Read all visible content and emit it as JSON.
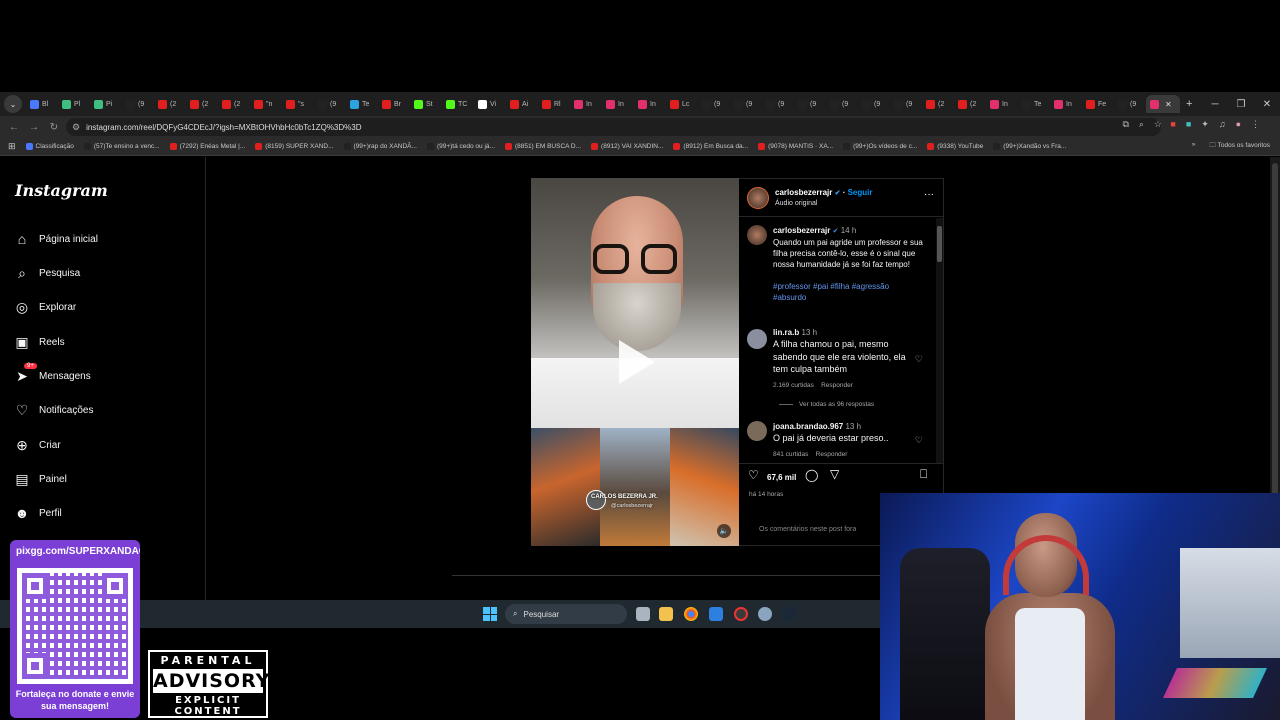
{
  "browser": {
    "tabs": [
      {
        "label": "Bl",
        "color": "#4a79ff"
      },
      {
        "label": "Pl",
        "color": "#3fbf7f"
      },
      {
        "label": "Pi",
        "color": "#3fbf7f"
      },
      {
        "label": "(9",
        "color": "#222222"
      },
      {
        "label": "(2",
        "color": "#e02020"
      },
      {
        "label": "(2",
        "color": "#e02020"
      },
      {
        "label": "(2",
        "color": "#e02020"
      },
      {
        "label": "\"n",
        "color": "#e02020"
      },
      {
        "label": "\"s",
        "color": "#e02020"
      },
      {
        "label": "(9",
        "color": "#222222"
      },
      {
        "label": "Te",
        "color": "#2aa3e0"
      },
      {
        "label": "Br",
        "color": "#e02020"
      },
      {
        "label": "St",
        "color": "#53fc18"
      },
      {
        "label": "TC",
        "color": "#53fc18"
      },
      {
        "label": "Vi",
        "color": "#ffffff"
      },
      {
        "label": "Ai",
        "color": "#e02020"
      },
      {
        "label": "Rl",
        "color": "#e02020"
      },
      {
        "label": "In",
        "color": "#e1306c"
      },
      {
        "label": "In",
        "color": "#e1306c"
      },
      {
        "label": "In",
        "color": "#e1306c"
      },
      {
        "label": "Lc",
        "color": "#e02020"
      },
      {
        "label": "(9",
        "color": "#222222"
      },
      {
        "label": "(9",
        "color": "#222222"
      },
      {
        "label": "(9",
        "color": "#222222"
      },
      {
        "label": "(9",
        "color": "#222222"
      },
      {
        "label": "(9",
        "color": "#222222"
      },
      {
        "label": "(9",
        "color": "#222222"
      },
      {
        "label": "(9",
        "color": "#222222"
      },
      {
        "label": "(2",
        "color": "#e02020"
      },
      {
        "label": "(2",
        "color": "#e02020"
      },
      {
        "label": "In",
        "color": "#e1306c"
      },
      {
        "label": "Te",
        "color": "#222222"
      },
      {
        "label": "In",
        "color": "#e1306c"
      },
      {
        "label": "Fe",
        "color": "#e02020"
      },
      {
        "label": "(9",
        "color": "#222222"
      },
      {
        "label": "",
        "color": "#e1306c",
        "active": true
      }
    ],
    "url": "instagram.com/reel/DQFyG4CDEcJ/?igsh=MXBtOHVhbHc0bTc1ZQ%3D%3D",
    "bookmarks": [
      {
        "label": "Classificação",
        "color": "#4a79ff"
      },
      {
        "label": "(57)Te ensino a venc...",
        "color": "#222222"
      },
      {
        "label": "(7292) Enéas Metal |...",
        "color": "#e02020"
      },
      {
        "label": "(8159) SUPER XAND...",
        "color": "#e02020"
      },
      {
        "label": "(99+)rap do XANDÃ...",
        "color": "#222222"
      },
      {
        "label": "(99+)tá cedo ou já...",
        "color": "#222222"
      },
      {
        "label": "(8851) EM BUSCA D...",
        "color": "#e02020"
      },
      {
        "label": "(8912) VAI XANDIN...",
        "color": "#e02020"
      },
      {
        "label": "(8912) Em Busca da...",
        "color": "#e02020"
      },
      {
        "label": "(9078) MANTIS · XA...",
        "color": "#e02020"
      },
      {
        "label": "(99+)Os vídeos de c...",
        "color": "#222222"
      },
      {
        "label": "(9338) YouTube",
        "color": "#e02020"
      },
      {
        "label": "(99+)Xandão vs Fra...",
        "color": "#222222"
      }
    ],
    "all_bookmarks_label": "Todos os favoritos"
  },
  "instagram": {
    "logo": "Instagram",
    "nav": [
      {
        "label": "Página inicial",
        "icon": "home-icon"
      },
      {
        "label": "Pesquisa",
        "icon": "search-icon"
      },
      {
        "label": "Explorar",
        "icon": "compass-icon"
      },
      {
        "label": "Reels",
        "icon": "reels-icon"
      },
      {
        "label": "Mensagens",
        "icon": "messages-icon",
        "badge": "9+"
      },
      {
        "label": "Notificações",
        "icon": "heart-icon"
      },
      {
        "label": "Criar",
        "icon": "plus-icon"
      },
      {
        "label": "Painel",
        "icon": "dashboard-icon"
      },
      {
        "label": "Perfil",
        "icon": "profile-icon"
      }
    ],
    "reel_overlay": {
      "name": "CARLOS BEZERRA JR.",
      "handle": "@carlosbezerrajr"
    },
    "post": {
      "username": "carlosbezerrajr",
      "follow": "Seguir",
      "audio": "Áudio original",
      "caption_user": "carlosbezerrajr",
      "caption_time": "14 h",
      "caption": "Quando um pai agride um professor e sua filha precisa contê-lo, esse é o sinal que nossa humanidade já se foi faz tempo!",
      "hashtags": "#professor #pai #filha #agressão #absurdo",
      "comments": [
        {
          "user": "lin.ra.b",
          "time": "13 h",
          "text": "A filha chamou o pai, mesmo sabendo que ele era violento, ela tem culpa também",
          "likes": "2.169 curtidas",
          "reply": "Responder",
          "view_replies": "Ver todas as 96 respostas"
        },
        {
          "user": "joana.brandao.967",
          "time": "13 h",
          "text": "O pai já deveria estar preso..",
          "likes": "841 curtidas",
          "reply": "Responder"
        }
      ],
      "likes_count": "67,6 mil",
      "posted_ago": "há 14 horas",
      "comments_disabled_note": "Os comentários neste post fora"
    }
  },
  "taskbar": {
    "search_placeholder": "Pesquisar"
  },
  "overlays": {
    "pix_url": "pixgg.com/SUPERXANDAO",
    "pix_caption": "Fortaleça no donate e envie sua mensagem!",
    "advisory_top": "PARENTAL",
    "advisory_mid": "ADVISORY",
    "advisory_bottom": "EXPLICIT CONTENT"
  }
}
